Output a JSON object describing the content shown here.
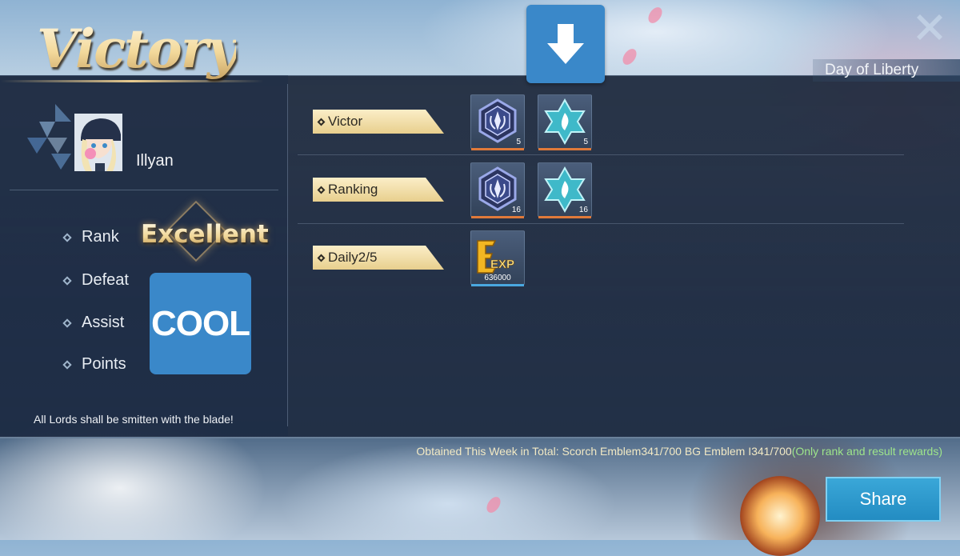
{
  "header": {
    "title": "Victory",
    "event": "Day of Liberty",
    "download_icon": "arrow-down-icon",
    "close_icon": "close-icon"
  },
  "player": {
    "name": "Illyan"
  },
  "stats": [
    {
      "label": "Rank"
    },
    {
      "label": "Defeat"
    },
    {
      "label": "Assist"
    },
    {
      "label": "Points"
    }
  ],
  "grades": {
    "rank": "Excellent",
    "result": "COOL"
  },
  "slogan": "All Lords shall be smitten with the blade!",
  "rewards": [
    {
      "label": "Victor",
      "items": [
        {
          "icon": "scorch-emblem-icon",
          "qty": "5"
        },
        {
          "icon": "bg-emblem-icon",
          "qty": "5"
        }
      ]
    },
    {
      "label": "Ranking",
      "items": [
        {
          "icon": "scorch-emblem-icon",
          "qty": "16"
        },
        {
          "icon": "bg-emblem-icon",
          "qty": "16"
        }
      ]
    },
    {
      "label": "Daily2/5",
      "items": [
        {
          "icon": "exp-icon",
          "icon_text": "EXP",
          "qty": "636000"
        }
      ]
    }
  ],
  "weekly_total": {
    "prefix": "Obtained This Week in Total: ",
    "scorch": "Scorch Emblem341/700",
    "bg": "BG Emblem I341/700",
    "note": "(Only rank and result rewards)"
  },
  "share_label": "Share",
  "colors": {
    "accent_blue": "#3a88c9",
    "label_gold": "#f0dca8",
    "rarity_orange": "#e07a3a",
    "rarity_blue": "#4aa8e0",
    "note_green": "#9ee58a"
  }
}
